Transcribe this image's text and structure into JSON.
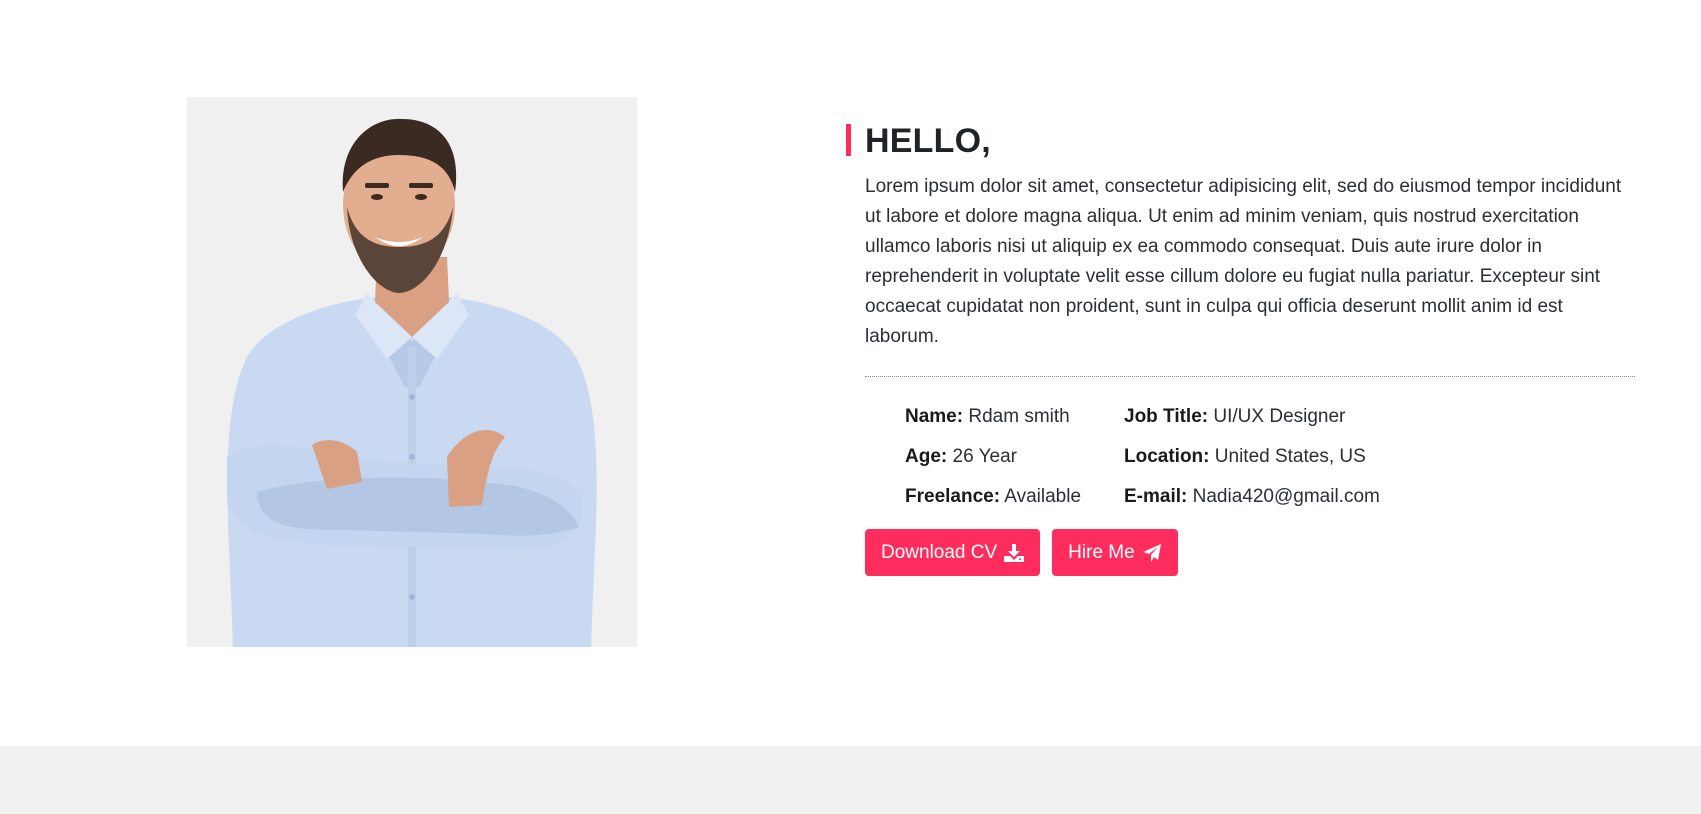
{
  "about": {
    "photo_alt": "Smiling man in a light blue shirt with arms crossed",
    "heading": "HELLO,",
    "description": "Lorem ipsum dolor sit amet, consectetur adipisicing elit, sed do eiusmod tempor incididunt ut labore et dolore magna aliqua. Ut enim ad minim veniam, quis nostrud exercitation ullamco laboris nisi ut aliquip ex ea commodo consequat. Duis aute irure dolor in reprehenderit in voluptate velit esse cillum dolore eu fugiat nulla pariatur. Excepteur sint occaecat cupidatat non proident, sunt in culpa qui officia deserunt mollit anim id est laborum.",
    "info_left": [
      {
        "label": "Name:",
        "value": "Rdam smith"
      },
      {
        "label": "Age:",
        "value": "26 Year"
      },
      {
        "label": "Freelance:",
        "value": "Available"
      }
    ],
    "info_right": [
      {
        "label": "Job Title:",
        "value": "UI/UX Designer"
      },
      {
        "label": "Location:",
        "value": "United States, US"
      },
      {
        "label": "E-mail:",
        "value": "Nadia420@gmail.com"
      }
    ],
    "buttons": {
      "download_label": "Download CV",
      "download_icon": "download-icon",
      "hire_label": "Hire Me",
      "hire_icon": "paper-plane-icon"
    }
  },
  "colors": {
    "accent": "#ff2d5e",
    "text": "#212529",
    "photo_background": "#f0f0f0",
    "footer_background": "#f1f1f1"
  }
}
